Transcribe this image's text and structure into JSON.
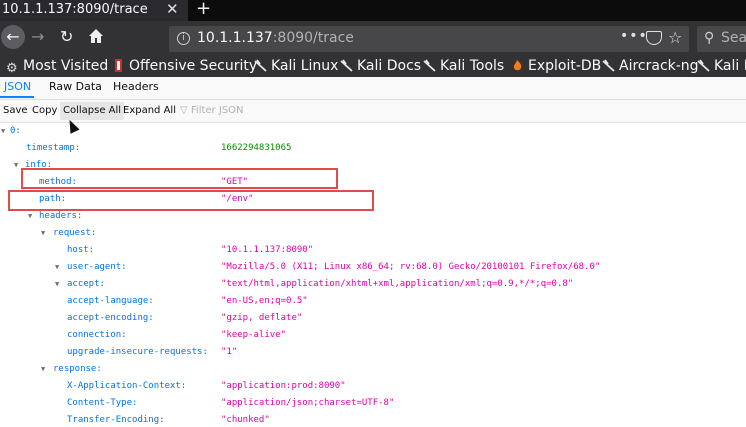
{
  "browser": {
    "tab_title": "10.1.1.137:8090/trace",
    "tab_close": "✕",
    "new_tab": "+",
    "url_host": "10.1.1.137",
    "url_rest": ":8090/trace",
    "page_actions": "•••",
    "search_placeholder": "Sea"
  },
  "bookmarks": [
    {
      "label": "Most Visited",
      "icon": "gear-icon"
    },
    {
      "label": "Offensive Security",
      "icon": "offsec-icon"
    },
    {
      "label": "Kali Linux",
      "icon": "kali-icon"
    },
    {
      "label": "Kali Docs",
      "icon": "kali-icon"
    },
    {
      "label": "Kali Tools",
      "icon": "kali-icon"
    },
    {
      "label": "Exploit-DB",
      "icon": "exploitdb-icon"
    },
    {
      "label": "Aircrack-ng",
      "icon": "aircrack-icon"
    },
    {
      "label": "Kali F",
      "icon": "kali-icon"
    }
  ],
  "viewer": {
    "tabs": [
      "JSON",
      "Raw Data",
      "Headers"
    ],
    "toolbar": {
      "save": "Save",
      "copy": "Copy",
      "collapse": "Collapse All",
      "expand": "Expand All",
      "filter": "Filter JSON"
    }
  },
  "tree": {
    "root": "0:",
    "timestamp_key": "timestamp:",
    "timestamp_val": "1662294831065",
    "info_key": "info:",
    "method_key": "method:",
    "method_val": "\"GET\"",
    "path_key": "path:",
    "path_val": "\"/env\"",
    "headers_key": "headers:",
    "request_key": "request:",
    "host_key": "host:",
    "host_val": "\"10.1.1.137:8090\"",
    "ua_key": "user-agent:",
    "ua_val": "\"Mozilla/5.0 (X11; Linux x86_64; rv:68.0) Gecko/20100101 Firefox/68.0\"",
    "accept_key": "accept:",
    "accept_val": "\"text/html,application/xhtml+xml,application/xml;q=0.9,*/*;q=0.8\"",
    "al_key": "accept-language:",
    "al_val": "\"en-US,en;q=0.5\"",
    "ae_key": "accept-encoding:",
    "ae_val": "\"gzip, deflate\"",
    "conn_key": "connection:",
    "conn_val": "\"keep-alive\"",
    "uir_key": "upgrade-insecure-requests:",
    "uir_val": "\"1\"",
    "response_key": "response:",
    "xac_key": "X-Application-Context:",
    "xac_val": "\"application:prod:8090\"",
    "ct_key": "Content-Type:",
    "ct_val": "\"application/json;charset=UTF-8\"",
    "te_key": "Transfer-Encoding:",
    "te_val": "\"chunked\""
  },
  "colors": {
    "key": "#0074e8",
    "string": "#dd00a9",
    "number": "#058b00",
    "highlight": "#e24b4b",
    "accent": "#0a84ff"
  }
}
